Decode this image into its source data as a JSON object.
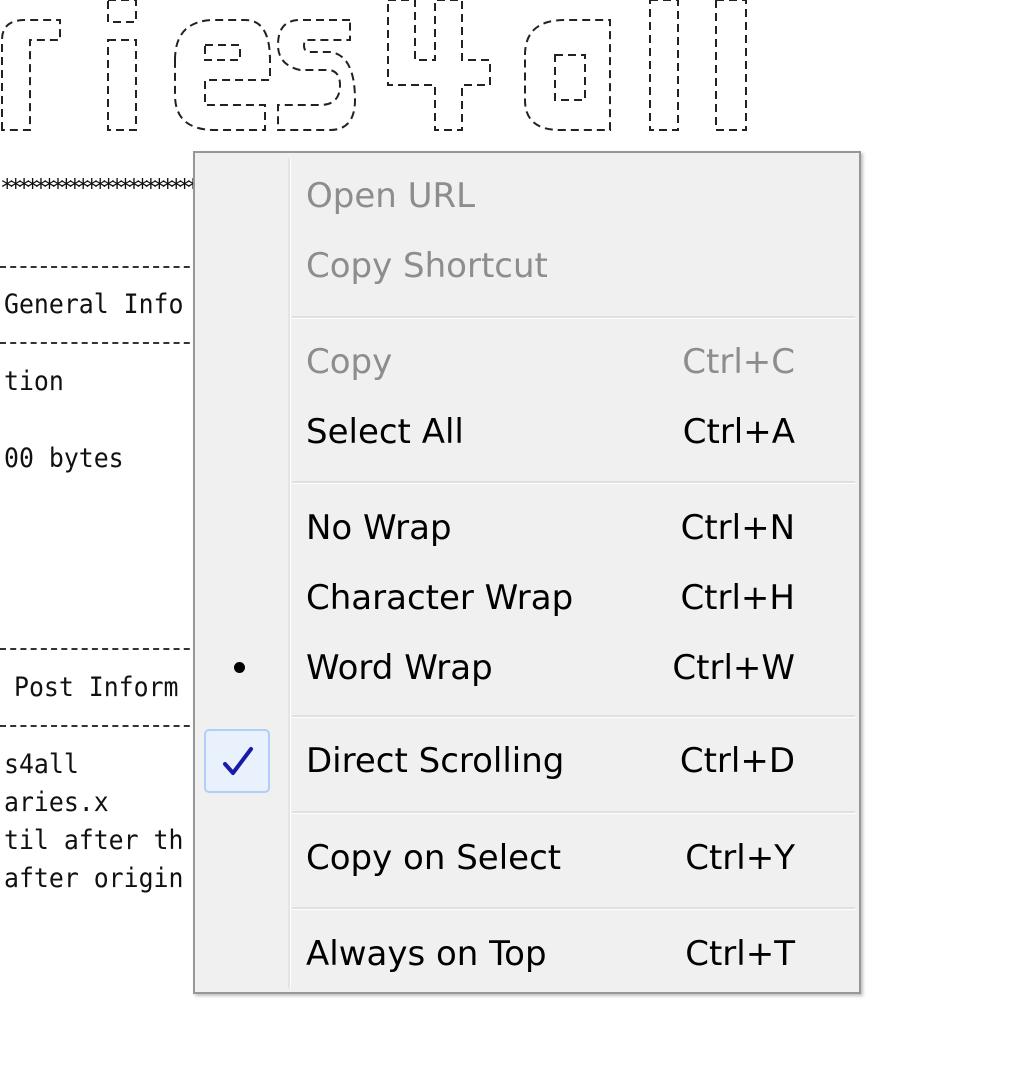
{
  "viewer": {
    "ascii_banner": "ries4all",
    "lines": [
      "General Info",
      "tion",
      "00 bytes",
      "Post Inform",
      "s4all",
      "aries.x",
      "til after th",
      "after origin"
    ]
  },
  "context_menu": {
    "open_url": {
      "label": "Open URL",
      "shortcut": ""
    },
    "copy_shortcut": {
      "label": "Copy Shortcut",
      "shortcut": ""
    },
    "copy": {
      "label": "Copy",
      "shortcut": "Ctrl+C"
    },
    "select_all": {
      "label": "Select All",
      "shortcut": "Ctrl+A"
    },
    "no_wrap": {
      "label": "No Wrap",
      "shortcut": "Ctrl+N"
    },
    "character_wrap": {
      "label": "Character Wrap",
      "shortcut": "Ctrl+H"
    },
    "word_wrap": {
      "label": "Word Wrap",
      "shortcut": "Ctrl+W",
      "state": "radio-selected"
    },
    "direct_scrolling": {
      "label": "Direct Scrolling",
      "shortcut": "Ctrl+D",
      "state": "checked"
    },
    "copy_on_select": {
      "label": "Copy on Select",
      "shortcut": "Ctrl+Y"
    },
    "always_on_top": {
      "label": "Always on Top",
      "shortcut": "Ctrl+T"
    }
  },
  "colors": {
    "menu_background": "#f0f0f0",
    "disabled_text": "#8d8d8d",
    "check_highlight": "#e8f1fc",
    "check_mark": "#1a1aa8"
  },
  "icons": {
    "radio": "radio-dot-icon",
    "check": "checkmark-icon"
  }
}
